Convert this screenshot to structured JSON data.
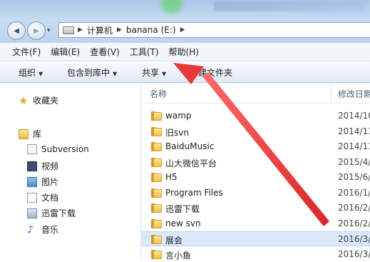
{
  "window": {
    "breadcrumb": [
      "计算机",
      "banana (E:)"
    ]
  },
  "nav_buttons": {
    "back_glyph": "◀",
    "forward_glyph": "▶",
    "dropdown_glyph": "▾"
  },
  "menubar": {
    "items": [
      "文件(F)",
      "编辑(E)",
      "查看(V)",
      "工具(T)",
      "帮助(H)"
    ]
  },
  "commandbar": {
    "organize": "组织",
    "include_in_library": "包含到库中",
    "share": "共享",
    "new_folder": "新建文件夹"
  },
  "navpane": {
    "favorites": "收藏夹",
    "libraries": "库",
    "library_items": [
      "Subversion",
      "视频",
      "图片",
      "文档",
      "迅雷下载",
      "音乐"
    ]
  },
  "content": {
    "columns": {
      "name": "名称",
      "date": "修改日期"
    },
    "rows": [
      {
        "name": "wamp",
        "date": "2014/10"
      },
      {
        "name": "旧svn",
        "date": "2014/11"
      },
      {
        "name": "BaiduMusic",
        "date": "2014/11"
      },
      {
        "name": "山大微信平台",
        "date": "2015/4/"
      },
      {
        "name": "H5",
        "date": "2015/6/"
      },
      {
        "name": "Program Files",
        "date": "2016/1/"
      },
      {
        "name": "迅雷下载",
        "date": "2016/2/"
      },
      {
        "name": "new svn",
        "date": "2016/2/"
      },
      {
        "name": "展会",
        "date": "2016/3/"
      },
      {
        "name": "言小鱼",
        "date": "2016/3/"
      }
    ],
    "selected_index": 8
  },
  "colors": {
    "annotation_arrow": "#e8383a",
    "selection": "#d9e9fb",
    "folder": "#f2c75a"
  }
}
